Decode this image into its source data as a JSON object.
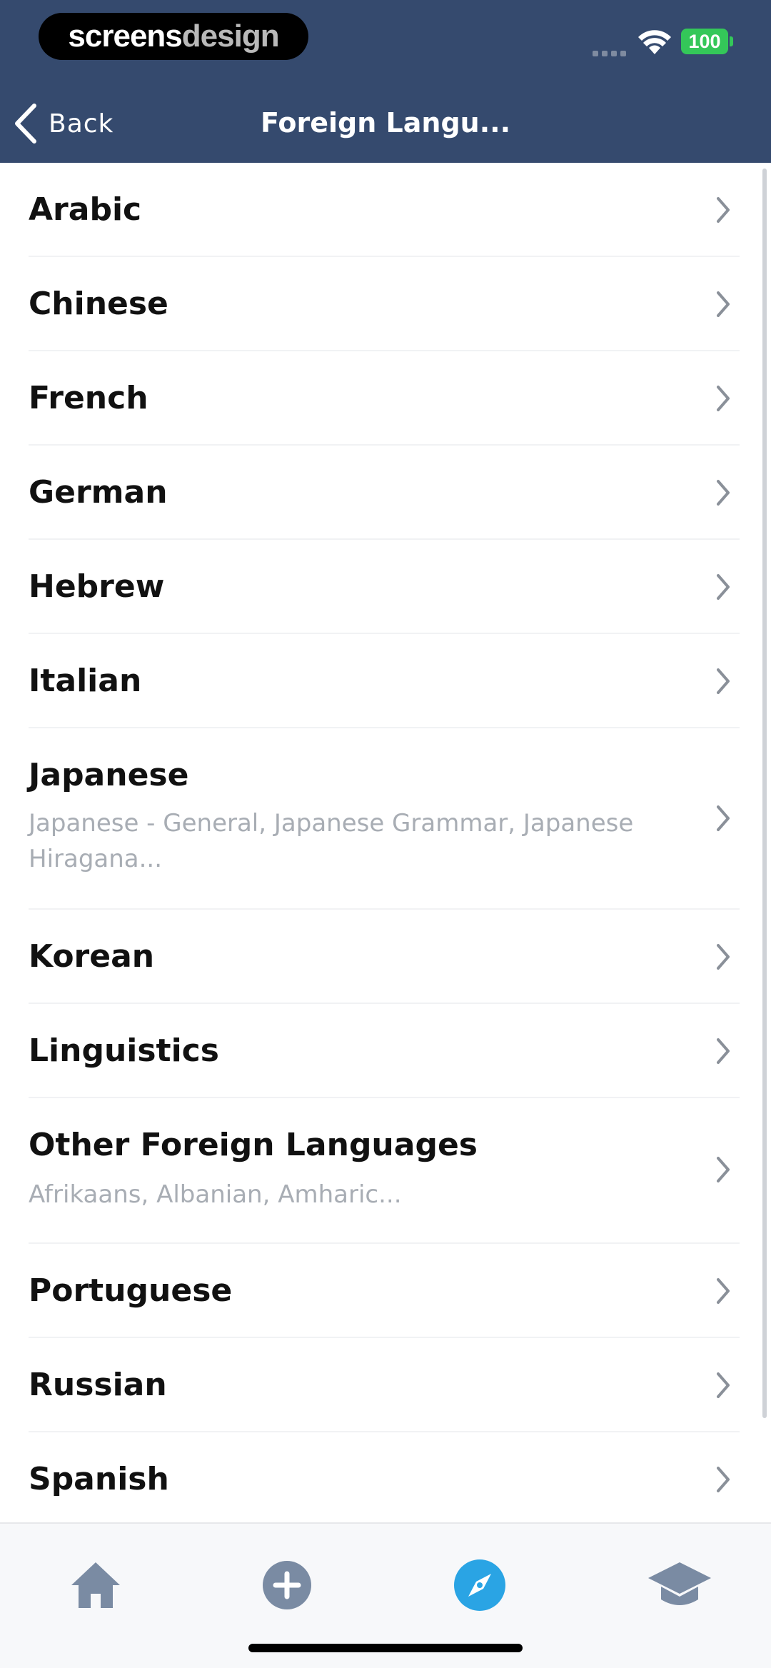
{
  "status_bar": {
    "brand_part1": "screens",
    "brand_part2": "design",
    "battery": "100"
  },
  "nav": {
    "back_label": "Back",
    "title": "Foreign Langu..."
  },
  "list": {
    "items": [
      {
        "title": "Arabic",
        "subtitle": ""
      },
      {
        "title": "Chinese",
        "subtitle": ""
      },
      {
        "title": "French",
        "subtitle": ""
      },
      {
        "title": "German",
        "subtitle": ""
      },
      {
        "title": "Hebrew",
        "subtitle": ""
      },
      {
        "title": "Italian",
        "subtitle": ""
      },
      {
        "title": "Japanese",
        "subtitle": "Japanese - General, Japanese Grammar, Japanese Hiragana..."
      },
      {
        "title": "Korean",
        "subtitle": ""
      },
      {
        "title": "Linguistics",
        "subtitle": ""
      },
      {
        "title": "Other Foreign Languages",
        "subtitle": "Afrikaans, Albanian, Amharic..."
      },
      {
        "title": "Portuguese",
        "subtitle": ""
      },
      {
        "title": "Russian",
        "subtitle": ""
      },
      {
        "title": "Spanish",
        "subtitle": ""
      }
    ]
  },
  "tabbar": {
    "tabs": [
      {
        "name": "home",
        "icon": "home-icon",
        "active": false
      },
      {
        "name": "add",
        "icon": "plus-circle-icon",
        "active": false
      },
      {
        "name": "explore",
        "icon": "compass-icon",
        "active": true
      },
      {
        "name": "learn",
        "icon": "graduation-cap-icon",
        "active": false
      }
    ],
    "active_color": "#2aa4e4",
    "inactive_color": "#7a8ba3"
  },
  "colors": {
    "header_bg": "#354a6e",
    "title_text": "#111111",
    "subtitle_text": "#a8adb4",
    "chevron": "#8a9099"
  }
}
